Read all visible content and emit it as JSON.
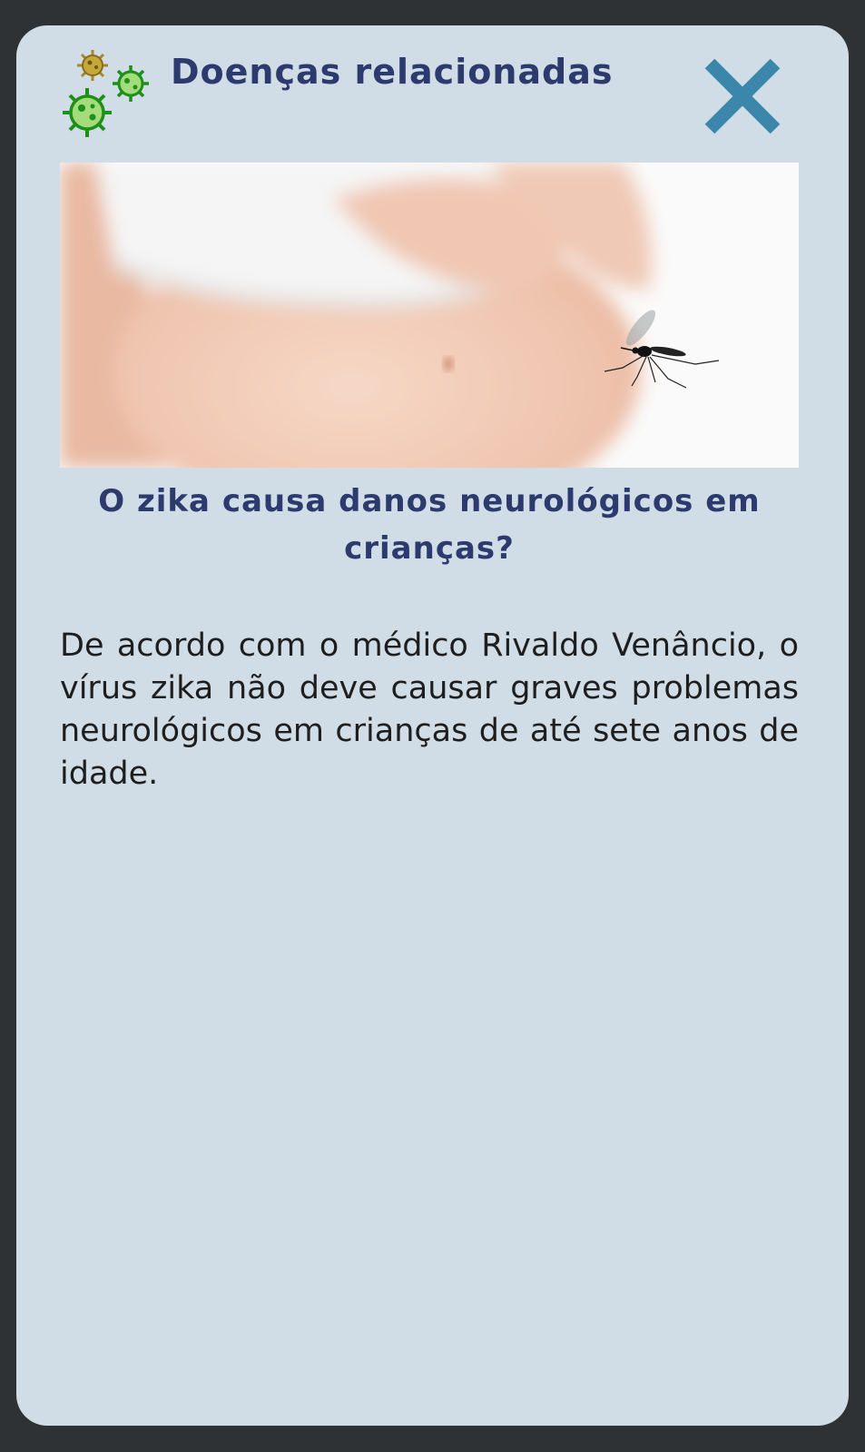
{
  "header": {
    "title": "Doenças relacionadas",
    "logo_icon": "virus-icon",
    "close_icon": "close-icon",
    "accent_color": "#3b87ac",
    "title_color": "#2c3a6e"
  },
  "hero_image": {
    "description_icon": "pregnant-belly-mosquito-image"
  },
  "article": {
    "question": "O zika causa danos neurológicos em crianças?",
    "body": "De acordo com o médico Rivaldo Venâncio, o vírus zika não deve causar graves problemas neurológicos em crianças de até sete anos de idade."
  },
  "colors": {
    "background": "#2e3235",
    "card": "#d0dde6",
    "virus_green": "#28a022",
    "virus_gold": "#b0901f"
  }
}
